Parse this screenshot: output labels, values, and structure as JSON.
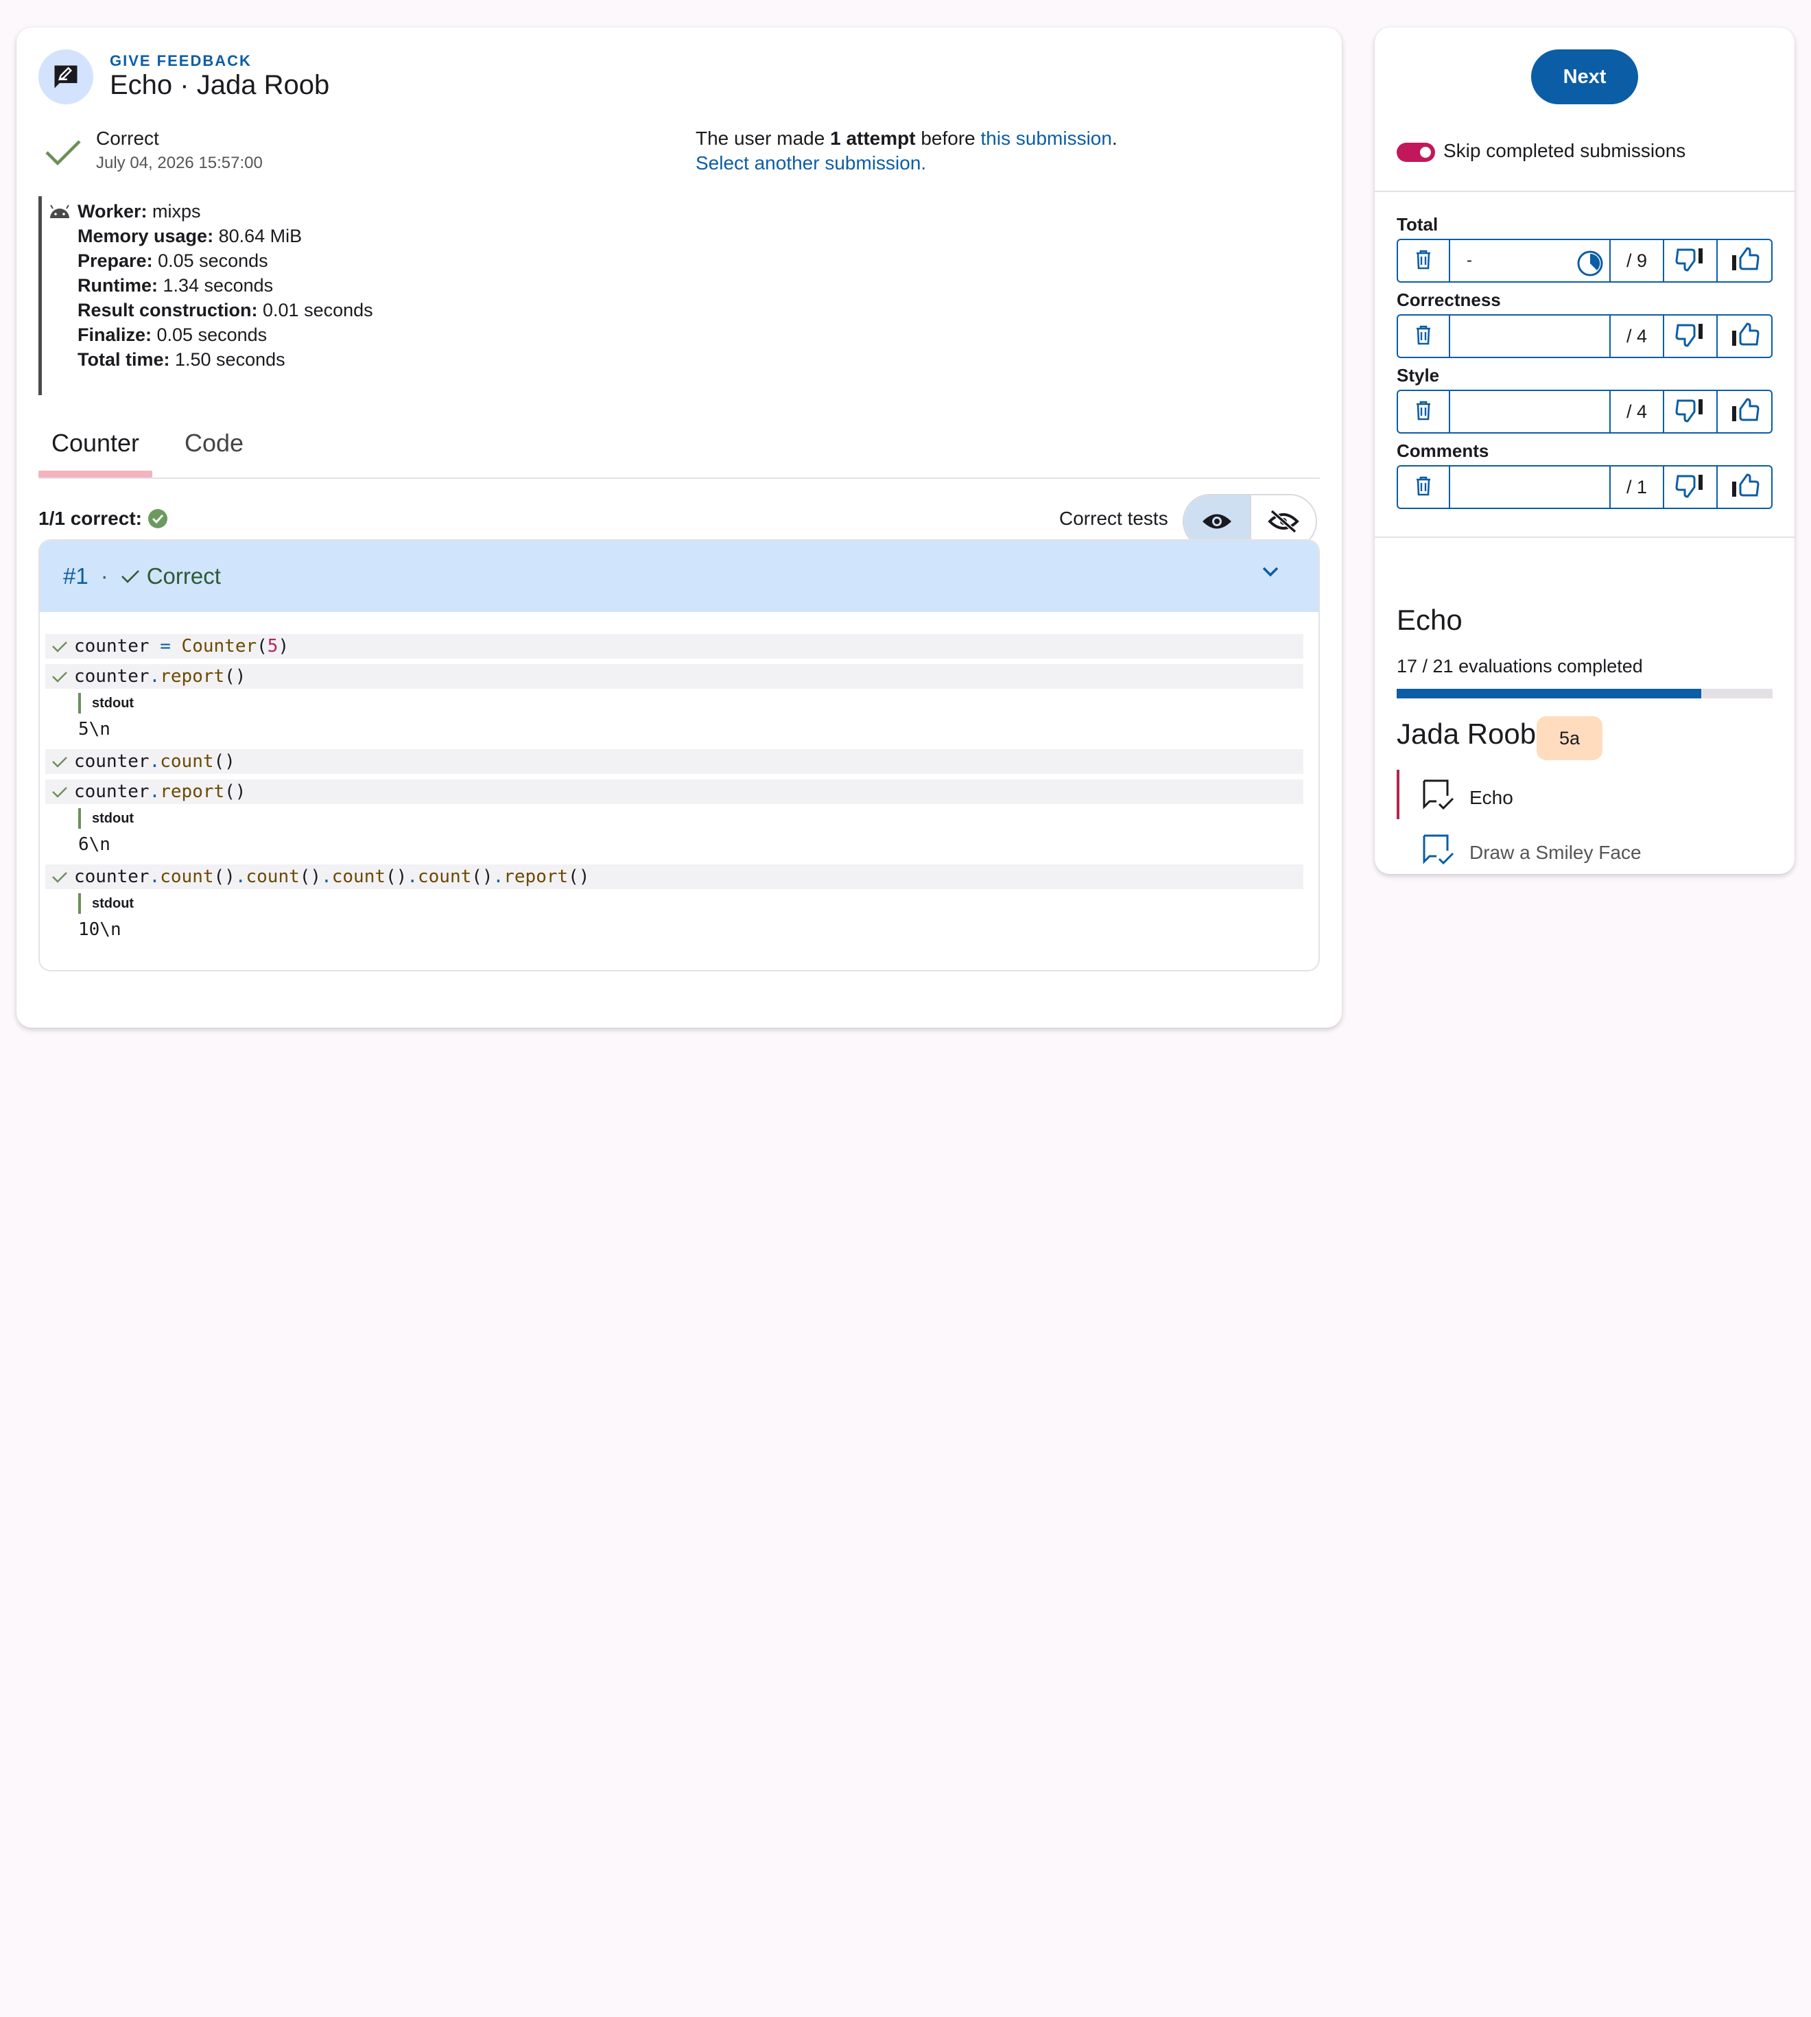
{
  "header": {
    "eyebrow": "GIVE FEEDBACK",
    "title": "Echo · Jada Roob"
  },
  "submission": {
    "status": "Correct",
    "date": "July 04, 2026 15:57:00",
    "attempt_prefix": "The user made ",
    "attempt_count": "1 attempt",
    "attempt_mid": " before ",
    "attempt_link": "this submission",
    "attempt_end": ".",
    "select_another": "Select another submission."
  },
  "worker": [
    {
      "k": "Worker:",
      "v": " mixps"
    },
    {
      "k": "Memory usage:",
      "v": " 80.64 MiB"
    },
    {
      "k": "Prepare:",
      "v": " 0.05 seconds"
    },
    {
      "k": "Runtime:",
      "v": " 1.34 seconds"
    },
    {
      "k": "Result construction:",
      "v": " 0.01 seconds"
    },
    {
      "k": "Finalize:",
      "v": " 0.05 seconds"
    },
    {
      "k": "Total time:",
      "v": " 1.50 seconds"
    }
  ],
  "tabs": [
    {
      "label": "Counter",
      "active": true
    },
    {
      "label": "Code",
      "active": false
    }
  ],
  "tests": {
    "summary": "1/1 correct:",
    "filter_label": "Correct tests",
    "group": {
      "number": "#1",
      "separator": "·",
      "status": "Correct"
    },
    "rows": [
      {
        "code_parts": [
          [
            "counter ",
            ""
          ],
          [
            "=",
            "op"
          ],
          [
            " ",
            ""
          ],
          [
            "Counter",
            "fn"
          ],
          [
            "(",
            ""
          ],
          [
            "5",
            "num-lit"
          ],
          [
            ")",
            ""
          ]
        ]
      },
      {
        "code_parts": [
          [
            "counter",
            ""
          ],
          [
            ".",
            "op"
          ],
          [
            "report",
            "fn"
          ],
          [
            "()",
            ""
          ]
        ],
        "stdout_label": "stdout",
        "stdout": "5\\n"
      },
      {
        "code_parts": [
          [
            "counter",
            ""
          ],
          [
            ".",
            "op"
          ],
          [
            "count",
            "fn"
          ],
          [
            "()",
            ""
          ]
        ]
      },
      {
        "code_parts": [
          [
            "counter",
            ""
          ],
          [
            ".",
            "op"
          ],
          [
            "report",
            "fn"
          ],
          [
            "()",
            ""
          ]
        ],
        "stdout_label": "stdout",
        "stdout": "6\\n"
      },
      {
        "code_parts": [
          [
            "counter",
            ""
          ],
          [
            ".",
            "op"
          ],
          [
            "count",
            "fn"
          ],
          [
            "()",
            ""
          ],
          [
            ".",
            "op"
          ],
          [
            "count",
            "fn"
          ],
          [
            "()",
            ""
          ],
          [
            ".",
            "op"
          ],
          [
            "count",
            "fn"
          ],
          [
            "()",
            ""
          ],
          [
            ".",
            "op"
          ],
          [
            "count",
            "fn"
          ],
          [
            "()",
            ""
          ],
          [
            ".",
            "op"
          ],
          [
            "report",
            "fn"
          ],
          [
            "()",
            ""
          ]
        ],
        "stdout_label": "stdout",
        "stdout": "10\\n"
      }
    ]
  },
  "side": {
    "next_label": "Next",
    "skip_label": "Skip completed submissions",
    "skip_enabled": true,
    "scores": [
      {
        "label": "Total",
        "value": "-",
        "max": "/ 9",
        "has_clock": true
      },
      {
        "label": "Correctness",
        "value": "",
        "max": "/ 4",
        "has_clock": false
      },
      {
        "label": "Style",
        "value": "",
        "max": "/ 4",
        "has_clock": false
      },
      {
        "label": "Comments",
        "value": "",
        "max": "/ 1",
        "has_clock": false
      }
    ],
    "exercise_title": "Echo",
    "evaluations_text": "17 / 21 evaluations completed",
    "evaluations_done": 17,
    "evaluations_total": 21,
    "user_name": "Jada Roob",
    "class_badge": "5a",
    "exercises": [
      {
        "name": "Echo",
        "icon": "feedback-check-icon",
        "current": true
      },
      {
        "name": "Draw a Smiley Face",
        "icon": "feedback-check-icon",
        "current": false
      }
    ]
  },
  "colors": {
    "primary": "#0b5da6",
    "accent": "#c2185b",
    "success": "#6b8f5a",
    "test_header_bg": "#d0e4fb",
    "badge_bg": "#ffdcbe"
  }
}
